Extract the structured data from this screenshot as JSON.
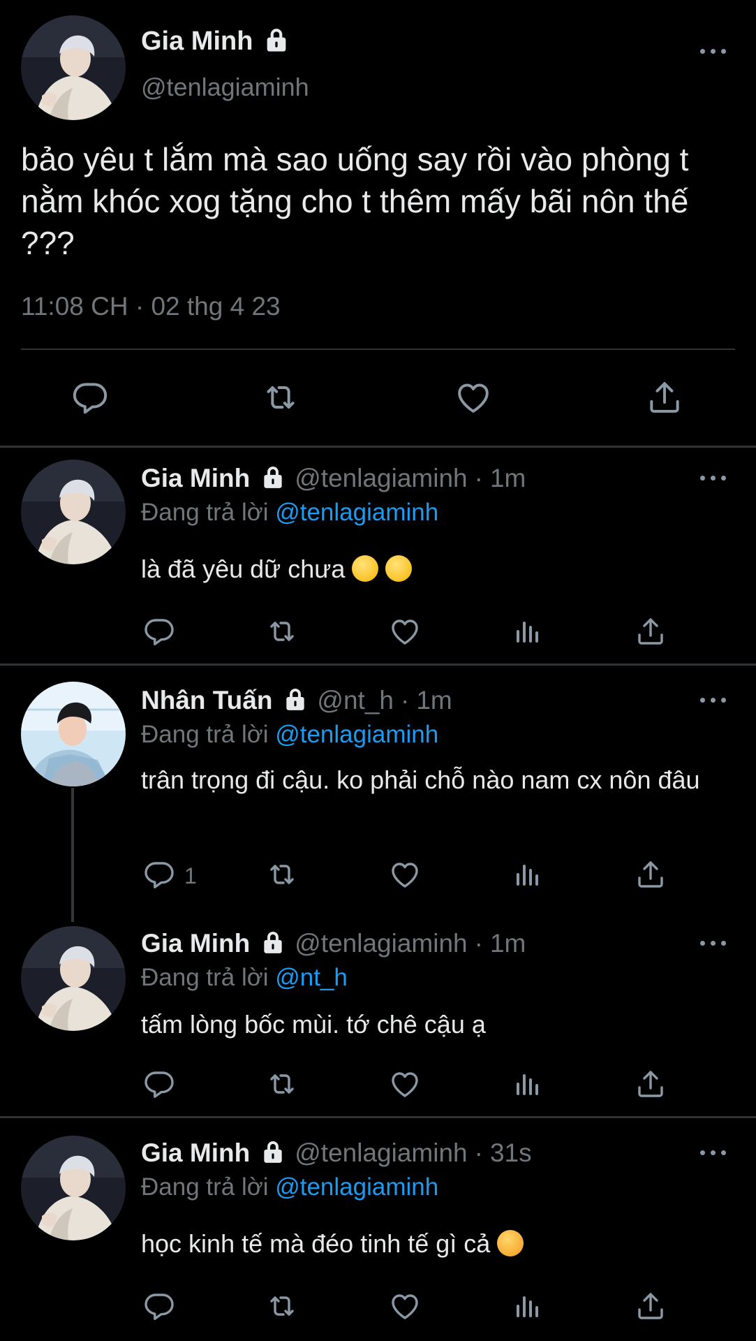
{
  "main_tweet": {
    "name": "Gia Minh",
    "handle": "@tenlagiaminh",
    "text": "bảo yêu t lắm mà sao uống say rồi vào phòng t nằm khóc xog tặng cho t thêm mấy bãi nôn thế ???",
    "timestamp": "11:08 CH · 02 thg 4 23",
    "actions": [
      "reply-icon",
      "retweet-icon",
      "like-icon",
      "share-icon"
    ]
  },
  "replies": [
    {
      "name": "Gia Minh",
      "handle": "@tenlagiaminh",
      "time": "1m",
      "replying_label": "Đang trả lời",
      "replying_to": "@tenlagiaminh",
      "text": "là đã yêu dữ chưa",
      "emoji": [
        "slightly-smiling-face",
        "slightly-smiling-face"
      ],
      "reply_count": ""
    },
    {
      "name": "Nhân Tuấn",
      "handle": "@nt_h",
      "time": "1m",
      "replying_label": "Đang trả lời",
      "replying_to": "@tenlagiaminh",
      "text": "trân trọng đi cậu. ko phải chỗ nào nam cx nôn đâu",
      "emoji": [],
      "reply_count": "1"
    },
    {
      "name": "Gia Minh",
      "handle": "@tenlagiaminh",
      "time": "1m",
      "replying_label": "Đang trả lời",
      "replying_to": "@nt_h",
      "text": "tấm lòng bốc mùi. tớ chê cậu ạ",
      "emoji": [],
      "reply_count": ""
    },
    {
      "name": "Gia Minh",
      "handle": "@tenlagiaminh",
      "time": "31s",
      "replying_label": "Đang trả lời",
      "replying_to": "@tenlagiaminh",
      "text": "học kinh tế mà đéo tinh tế gì cả",
      "emoji": [
        "angry-face"
      ],
      "reply_count": ""
    }
  ],
  "colors": {
    "background": "#000000",
    "primary_text": "#e7e9ea",
    "secondary_text": "#71767b",
    "mention": "#1d9bf0",
    "divider": "#2f3336"
  }
}
